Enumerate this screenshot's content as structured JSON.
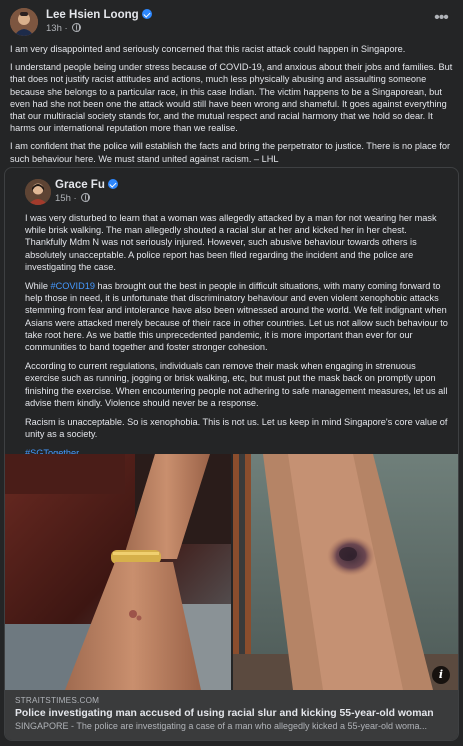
{
  "post": {
    "author": "Lee Hsien Loong",
    "timestamp": "13h",
    "paragraphs": [
      "I am very disappointed and seriously concerned that this racist attack could happen in Singapore.",
      "I understand people being under stress because of COVID-19, and anxious about their jobs and families. But that does not justify racist attitudes and actions, much less physically abusing and assaulting someone because she belongs to a particular race, in this case Indian. The victim happens to be a Singaporean, but even had she not been one the attack would still have been wrong and shameful. It goes against everything that our multiracial society stands for, and the mutual respect and racial harmony that we hold so dear. It harms our international reputation more than we realise.",
      "I am confident that the police will establish the facts and bring the perpetrator to justice. There is no place for such behaviour here. We must stand united against racism. – LHL"
    ]
  },
  "shared_post": {
    "author": "Grace Fu",
    "timestamp": "15h",
    "paragraphs": [
      "I was very disturbed to learn that a woman was allegedly attacked by a man for not wearing her mask while brisk walking. The man allegedly shouted a racial slur at her and kicked her in her chest. Thankfully Mdm N was not seriously injured. However, such abusive behaviour towards others is absolutely unacceptable. A police report has been filed regarding the incident and the police are investigating the case.",
      "According to current regulations, individuals can remove their mask when engaging in strenuous exercise such as running, jogging or brisk walking, etc, but must put the mask back on promptly upon finishing the exercise. When encountering people not adhering to safe management measures, let us all advise them kindly. Violence should never be a response.",
      "Racism is unacceptable. So is xenophobia. This is not us. Let us keep in mind Singapore's core value of unity as a society."
    ],
    "para2_before_tag": "While ",
    "para2_tag": "#COVID19",
    "para2_after_tag": " has brought out the best in people in difficult situations, with many coming forward to help those in need, it is unfortunate that discriminatory behaviour and even violent xenophobic attacks stemming from fear and intolerance have also been witnessed around the world. We felt indignant when Asians were attacked merely because of their race in other countries. Let us not allow such behaviour to take root here. As we battle this unprecedented pandemic, it is more important than ever for our communities to band together and foster stronger cohesion.",
    "hashtag": "#SGTogether"
  },
  "link_preview": {
    "domain": "STRAITSTIMES.COM",
    "title": "Police investigating man accused of using racial slur and kicking 55-year-old woman",
    "description": "SINGAPORE - The police are investigating a case of a man who allegedly kicked a 55-year-old woma..."
  },
  "icons": {
    "more": "more-options-icon",
    "verified": "verified-badge-icon",
    "audience": "globe-icon",
    "info": "info-icon"
  },
  "colors": {
    "background": "#242526",
    "text": "#e4e6eb",
    "secondary_text": "#b0b3b8",
    "link": "#4599ff",
    "verified": "#2d88ff"
  }
}
